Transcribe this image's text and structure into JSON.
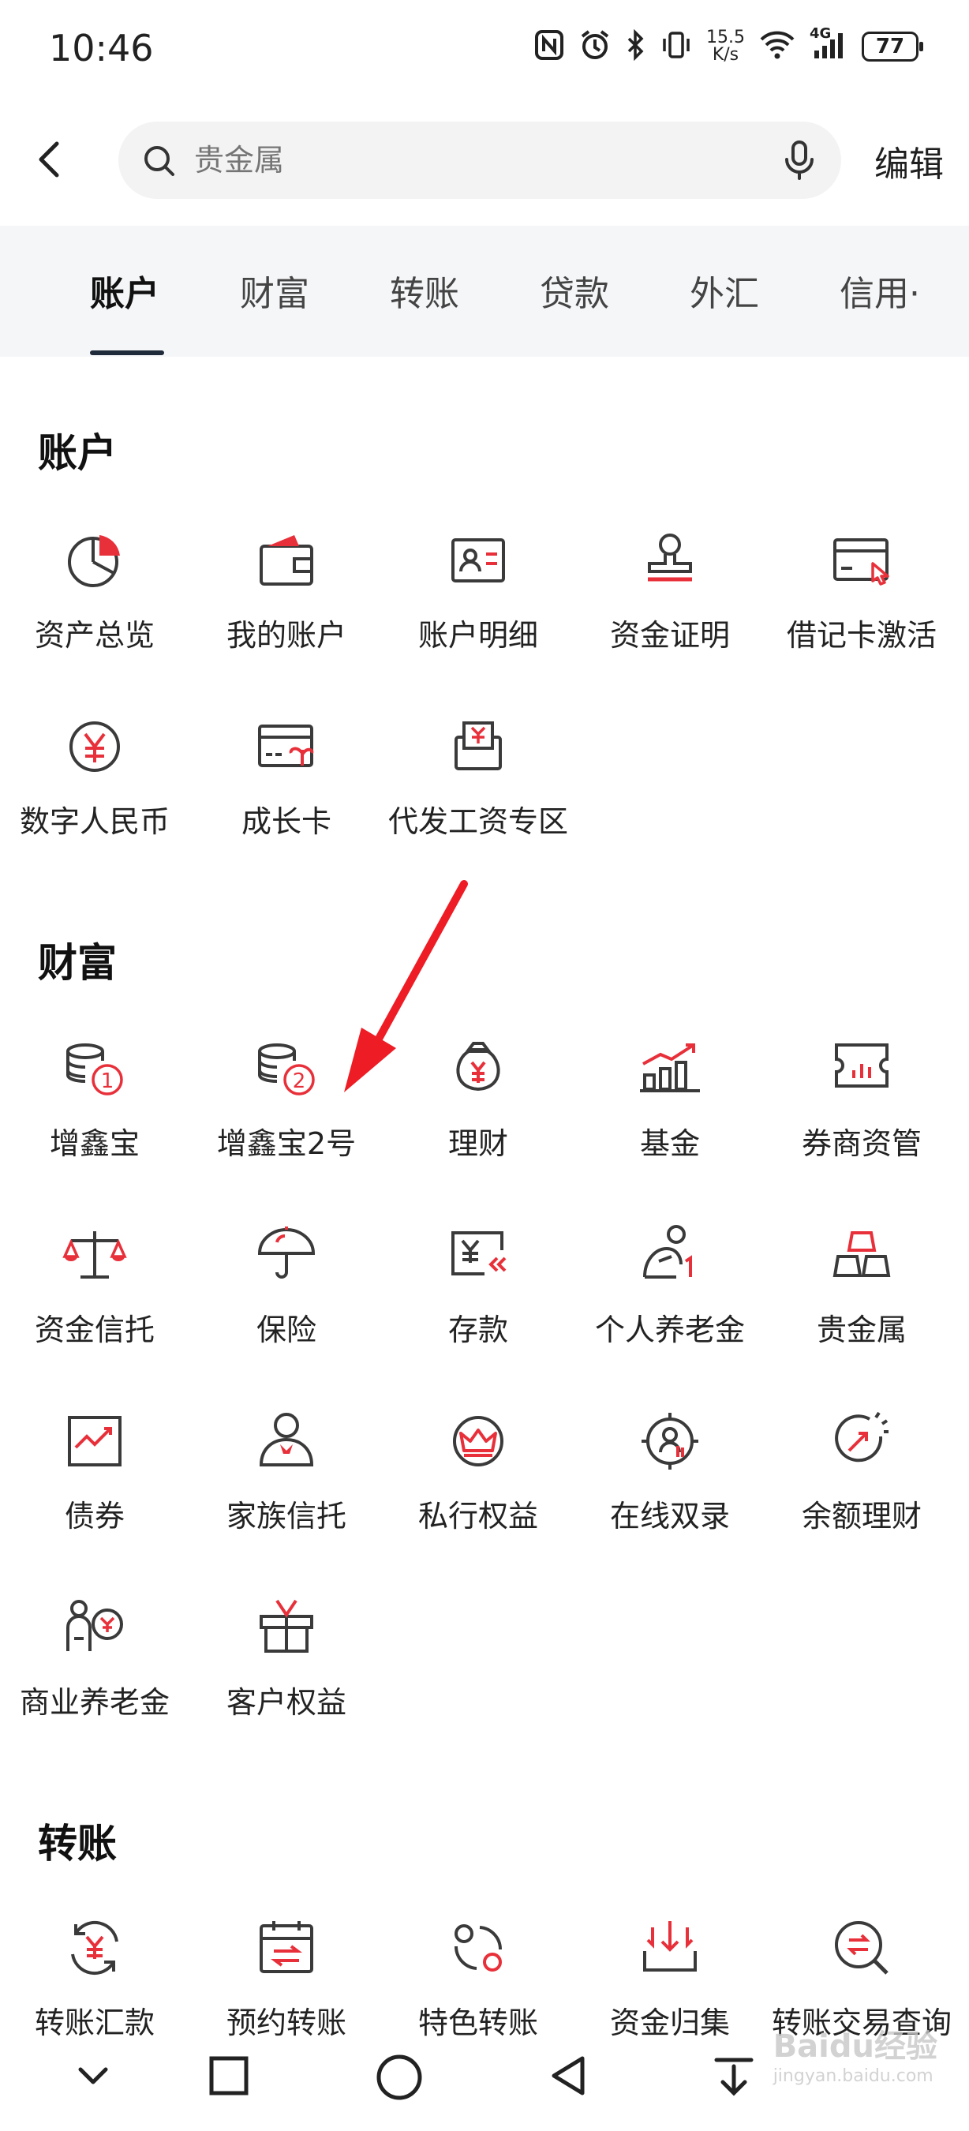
{
  "status_bar": {
    "time": "10:46",
    "net_speed_value": "15.5",
    "net_speed_unit": "K/s",
    "network": "4G",
    "battery": "77"
  },
  "search": {
    "placeholder": "贵金属",
    "edit_label": "编辑"
  },
  "tabs": [
    {
      "label": "账户",
      "active": true
    },
    {
      "label": "财富"
    },
    {
      "label": "转账"
    },
    {
      "label": "贷款"
    },
    {
      "label": "外汇"
    },
    {
      "label": "信用·"
    }
  ],
  "sections": {
    "account": {
      "title": "账户",
      "items": [
        {
          "label": "资产总览",
          "icon": "pie-chart-icon"
        },
        {
          "label": "我的账户",
          "icon": "wallet-icon"
        },
        {
          "label": "账户明细",
          "icon": "id-card-icon"
        },
        {
          "label": "资金证明",
          "icon": "stamp-icon"
        },
        {
          "label": "借记卡激活",
          "icon": "card-tap-icon"
        },
        {
          "label": "数字人民币",
          "icon": "digital-yuan-icon"
        },
        {
          "label": "成长卡",
          "icon": "growth-card-icon"
        },
        {
          "label": "代发工资专区",
          "icon": "salary-envelope-icon"
        }
      ]
    },
    "wealth": {
      "title": "财富",
      "items": [
        {
          "label": "增鑫宝",
          "icon": "coins-one-icon",
          "badge": "1"
        },
        {
          "label": "增鑫宝2号",
          "icon": "coins-two-icon",
          "badge": "2"
        },
        {
          "label": "理财",
          "icon": "money-bag-icon"
        },
        {
          "label": "基金",
          "icon": "bar-trend-icon"
        },
        {
          "label": "券商资管",
          "icon": "ticket-chart-icon"
        },
        {
          "label": "资金信托",
          "icon": "scale-icon"
        },
        {
          "label": "保险",
          "icon": "umbrella-icon"
        },
        {
          "label": "存款",
          "icon": "deposit-icon"
        },
        {
          "label": "个人养老金",
          "icon": "elder-icon"
        },
        {
          "label": "贵金属",
          "icon": "gold-bars-icon"
        },
        {
          "label": "债券",
          "icon": "bond-chart-icon"
        },
        {
          "label": "家族信托",
          "icon": "family-person-icon"
        },
        {
          "label": "私行权益",
          "icon": "crown-icon"
        },
        {
          "label": "在线双录",
          "icon": "online-record-icon"
        },
        {
          "label": "余额理财",
          "icon": "balance-arrow-icon"
        },
        {
          "label": "商业养老金",
          "icon": "commercial-pension-icon"
        },
        {
          "label": "客户权益",
          "icon": "gift-icon"
        }
      ]
    },
    "transfer": {
      "title": "转账",
      "items": [
        {
          "label": "转账汇款",
          "icon": "yuan-refresh-icon"
        },
        {
          "label": "预约转账",
          "icon": "calendar-transfer-icon"
        },
        {
          "label": "特色转账",
          "icon": "special-transfer-icon"
        },
        {
          "label": "资金归集",
          "icon": "fund-collect-icon"
        },
        {
          "label": "转账交易查询",
          "icon": "transfer-search-icon"
        }
      ]
    }
  },
  "watermark": {
    "brand": "Baidu经验",
    "url": "jingyan.baidu.com"
  },
  "colors": {
    "accent": "#e8303a",
    "icon_stroke": "#3a3a3a",
    "tab_bg": "#f5f6f8",
    "search_bg": "#f3f3f3"
  }
}
